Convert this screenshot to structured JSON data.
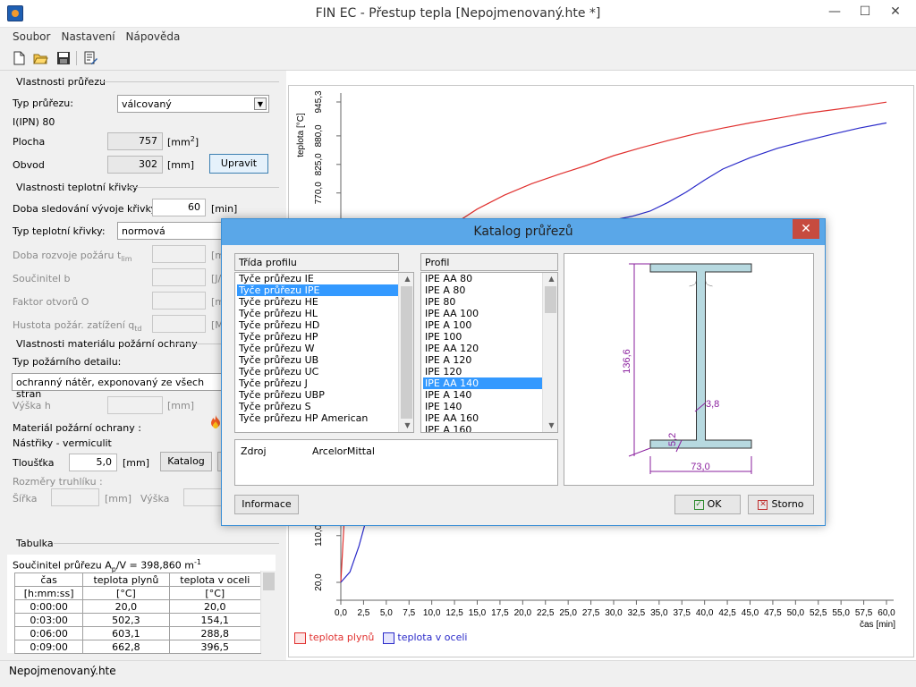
{
  "window": {
    "title": "FIN EC - Přestup tepla [Nepojmenovaný.hte *]",
    "min": "—",
    "max": "☐",
    "close": "✕"
  },
  "menu": [
    "Soubor",
    "Nastavení",
    "Nápověda"
  ],
  "section_profile": {
    "title": "Vlastnosti průřezu",
    "type_label": "Typ průřezu:",
    "type_value": "válcovaný",
    "profile_name": "I(IPN) 80",
    "area_label": "Plocha",
    "area_value": "757",
    "area_unit": "[mm",
    "area_unit_sup": "2",
    "area_unit_end": "]",
    "perimeter_label": "Obvod",
    "perimeter_value": "302",
    "perimeter_unit": "[mm]",
    "edit_button": "Upravit"
  },
  "section_curve": {
    "title": "Vlastnosti teplotní křivky",
    "duration_label": "Doba sledování vývoje křivky",
    "duration_value": "60",
    "duration_unit": "[min]",
    "curve_type_label": "Typ teplotní křivky:",
    "curve_type_value": "normová",
    "fire_dev_label": "Doba rozvoje požáru t",
    "fire_dev_sub": "lim",
    "fire_dev_unit": "[m",
    "coef_b_label": "Součinitel b",
    "coef_b_unit": "[J/",
    "opening_label": "Faktor otvorů O",
    "opening_unit": "[m",
    "density_label": "Hustota požár. zatížení q",
    "density_sub": "td",
    "density_unit": "[M"
  },
  "section_protection": {
    "title": "Vlastnosti materiálu požární ochrany",
    "detail_label": "Typ požárního detailu:",
    "detail_value": "ochranný nátěr, exponovaný ze všech stran",
    "height_label": "Výška h",
    "height_unit": "[mm]",
    "material_label": "Materiál požární ochrany :",
    "material_value": "Nástřiky - vermiculit",
    "thickness_label": "Tloušťka",
    "thickness_value": "5,0",
    "thickness_unit": "[mm]",
    "catalog_button": "Katalog",
    "box_label": "Rozměry truhlíku :",
    "width_label": "Šířka",
    "width_unit": "[mm]",
    "box_height_label": "Výška"
  },
  "table": {
    "title": "Tabulka",
    "factor_prefix": "Součinitel průřezu A",
    "factor_sub": "p",
    "factor_mid": "/V = 398,860 m",
    "factor_sup": "-1",
    "headers": [
      [
        "čas",
        "teplota plynů",
        "teplota v oceli"
      ],
      [
        "[h:mm:ss]",
        "[°C]",
        "[°C]"
      ]
    ],
    "rows": [
      [
        "0:00:00",
        "20,0",
        "20,0"
      ],
      [
        "0:03:00",
        "502,3",
        "154,1"
      ],
      [
        "0:06:00",
        "603,1",
        "288,8"
      ],
      [
        "0:09:00",
        "662,8",
        "396,5"
      ]
    ]
  },
  "status": "Nepojmenovaný.hte",
  "chart_data": {
    "type": "line",
    "ylabel": "teplota [°C]",
    "xlabel": "čas [min]",
    "ylim": [
      20.0,
      945.3
    ],
    "xlim": [
      0,
      60
    ],
    "y_ticks": [
      "945,3",
      "880,0",
      "825,0",
      "770,0",
      "110,0",
      "20,0"
    ],
    "x_ticks": [
      "0,0",
      "2,5",
      "5,0",
      "7,5",
      "10,0",
      "12,5",
      "15,0",
      "17,5",
      "20,0",
      "22,5",
      "25,0",
      "27,5",
      "30,0",
      "32,5",
      "35,0",
      "37,5",
      "40,0",
      "42,5",
      "45,0",
      "47,5",
      "50,0",
      "52,5",
      "55,0",
      "57,5",
      "60,0"
    ],
    "series": [
      {
        "name": "teplota plynů",
        "color": "#e0312f",
        "x": [
          0,
          0.5,
          1,
          2,
          3,
          5,
          7,
          9,
          12,
          15,
          18,
          21,
          24,
          27,
          30,
          33,
          36,
          39,
          42,
          45,
          48,
          51,
          54,
          57,
          60
        ],
        "y": [
          20,
          180,
          350,
          445,
          502,
          576,
          624,
          663,
          705,
          739,
          766,
          788,
          806,
          823,
          842,
          857,
          871,
          884,
          895,
          905,
          914,
          923,
          930,
          937,
          945
        ]
      },
      {
        "name": "teplota v oceli",
        "color": "#2a2ac9",
        "x": [
          0,
          1,
          2,
          3,
          4,
          5,
          6,
          7,
          9,
          12,
          15,
          18,
          21,
          24,
          27,
          30,
          32,
          34,
          36,
          38,
          40,
          42,
          45,
          48,
          51,
          54,
          57,
          60
        ],
        "y": [
          20,
          40,
          90,
          154,
          210,
          255,
          289,
          320,
          397,
          470,
          560,
          620,
          666,
          700,
          712,
          718,
          725,
          735,
          752,
          772,
          795,
          816,
          838,
          856,
          870,
          883,
          895,
          905
        ]
      }
    ]
  },
  "dialog": {
    "title": "Katalog průřezů",
    "close": "✕",
    "class_header": "Třída profilu",
    "classes": [
      "Tyče průřezu IE",
      "Tyče průřezu IPE",
      "Tyče průřezu HE",
      "Tyče průřezu HL",
      "Tyče průřezu HD",
      "Tyče průřezu HP",
      "Tyče průřezu W",
      "Tyče průřezu UB",
      "Tyče průřezu UC",
      "Tyče průřezu J",
      "Tyče průřezu UBP",
      "Tyče průřezu S",
      "Tyče průřezu HP American"
    ],
    "selected_class": 1,
    "profile_header": "Profil",
    "profiles": [
      "IPE AA 80",
      "IPE A 80",
      "IPE 80",
      "IPE AA 100",
      "IPE A 100",
      "IPE 100",
      "IPE AA 120",
      "IPE A 120",
      "IPE 120",
      "IPE AA 140",
      "IPE A 140",
      "IPE 140",
      "IPE AA 160",
      "IPE A 160"
    ],
    "selected_profile": 9,
    "source_label": "Zdroj",
    "source_value": "ArcelorMittal",
    "info_button": "Informace",
    "ok_button": "OK",
    "cancel_button": "Storno",
    "dim_height": "136,6",
    "dim_web": "3,8",
    "dim_flange": "5,2",
    "dim_width": "73,0"
  },
  "legend": [
    "teplota plynů",
    "teplota v oceli"
  ],
  "colors": {
    "gas": "#e0312f",
    "steel": "#2a2ac9",
    "selection": "#3399ff",
    "section_fill": "#b7d9e0"
  }
}
